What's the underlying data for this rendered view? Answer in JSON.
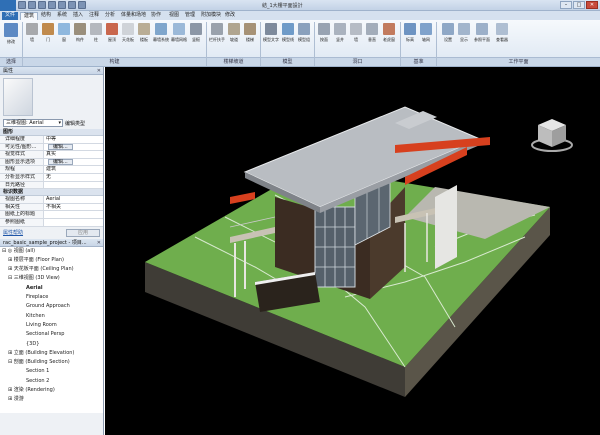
{
  "window": {
    "title": "結_1大樓平面設計",
    "controls": [
      "–",
      "□",
      "✕"
    ]
  },
  "ribbon_tabs": [
    "文件",
    "建筑",
    "结构",
    "系统",
    "插入",
    "注释",
    "分析",
    "体量和场地",
    "协作",
    "视图",
    "管理",
    "附加模块",
    "修改"
  ],
  "ribbon": {
    "panels": [
      {
        "label": "选择",
        "id": "select"
      },
      {
        "label": "构建",
        "id": "build"
      },
      {
        "label": "楼梯坡道",
        "id": "stairs"
      },
      {
        "label": "模型",
        "id": "model"
      },
      {
        "label": "洞口",
        "id": "opening"
      },
      {
        "label": "基准",
        "id": "datum"
      },
      {
        "label": "工作平面",
        "id": "workplane"
      }
    ],
    "buttons": [
      "修改",
      "墙",
      "门",
      "窗",
      "构件",
      "柱",
      "屋顶",
      "天花板",
      "楼板",
      "幕墙系统",
      "幕墙网格",
      "竖梃",
      "栏杆扶手",
      "坡道",
      "楼梯",
      "模型文字",
      "模型线",
      "模型组",
      "按面",
      "竖井",
      "墙",
      "垂直",
      "老虎窗",
      "标高",
      "轴网",
      "设置",
      "显示",
      "参照平面",
      "查看器"
    ],
    "workplane_label": "工作平面",
    "datum_label": "基准"
  },
  "properties": {
    "panel_title": "属性",
    "close_glyph": "✕",
    "type_selector": "三维视图: Aerial",
    "edit_type": "编辑类型",
    "group_graphics": "图形",
    "rows_graphics": [
      {
        "k": "详细程度",
        "v": "中等"
      },
      {
        "k": "可见性/图形...",
        "v": "",
        "button": "编辑..."
      },
      {
        "k": "视觉样式",
        "v": "真实"
      },
      {
        "k": "图形显示选项",
        "v": "",
        "button": "编辑..."
      },
      {
        "k": "规程",
        "v": "建筑"
      },
      {
        "k": "分析显示样式",
        "v": "无"
      },
      {
        "k": "日光路径",
        "v": ""
      }
    ],
    "group_identity": "标识数据",
    "rows_identity": [
      {
        "k": "视图名称",
        "v": "Aerial"
      },
      {
        "k": "相关性",
        "v": "不相关"
      },
      {
        "k": "图纸上的标题",
        "v": ""
      },
      {
        "k": "参照图纸",
        "v": ""
      }
    ],
    "help_link": "属性帮助",
    "apply_label": "应用"
  },
  "browser": {
    "title": "rac_basic_sample_project - 项目...",
    "close_glyph": "✕",
    "nodes": [
      {
        "text": "⊟ ◎ 视图 (all)",
        "indent": 2
      },
      {
        "text": "⊞ 楼层平面 (Floor Plan)",
        "indent": 8
      },
      {
        "text": "⊞ 天花板平面 (Ceiling Plan)",
        "indent": 8
      },
      {
        "text": "⊟ 三维视图 (3D View)",
        "indent": 8
      },
      {
        "text": "Aerial",
        "indent": 26,
        "selected": true
      },
      {
        "text": "Fireplace",
        "indent": 26
      },
      {
        "text": "Ground Approach",
        "indent": 26
      },
      {
        "text": "Kitchen",
        "indent": 26
      },
      {
        "text": "Living Room",
        "indent": 26
      },
      {
        "text": "Sectional Persp",
        "indent": 26
      },
      {
        "text": "{3D}",
        "indent": 26
      },
      {
        "text": "⊞ 立面 (Building Elevation)",
        "indent": 8
      },
      {
        "text": "⊟ 剖面 (Building Section)",
        "indent": 8
      },
      {
        "text": "Section 1",
        "indent": 26
      },
      {
        "text": "Section 2",
        "indent": 26
      },
      {
        "text": "⊞ 渲染 (Rendering)",
        "indent": 8
      },
      {
        "text": "⊞ 漫游",
        "indent": 8
      }
    ]
  },
  "colors": {
    "accent": "#2f6fb5",
    "viewport_bg": "#000000",
    "lawn": "#6aa84f",
    "roof": "#b8bcc2",
    "beam": "#d93a1c"
  },
  "viewport": {
    "view_name": "Aerial",
    "visual_style": "真实"
  }
}
